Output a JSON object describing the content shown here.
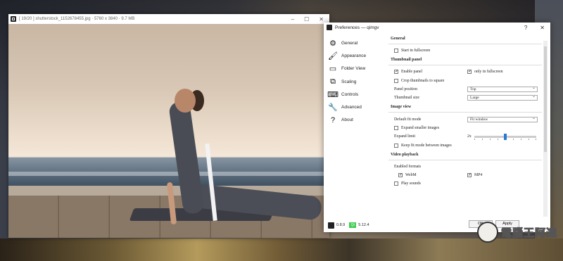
{
  "viewer": {
    "title": "[ 19/20 ] shutterstock_1152678455.jpg · 5760 x 3840 · 9.7 MB"
  },
  "prefs": {
    "title": "Preferences — qimgv",
    "help_glyph": "?",
    "close_glyph": "✕",
    "sidebar": [
      {
        "label": "General",
        "icon": "gear-icon"
      },
      {
        "label": "Appearance",
        "icon": "brush-icon"
      },
      {
        "label": "Folder View",
        "icon": "folder-icon"
      },
      {
        "label": "Scaling",
        "icon": "scaling-icon"
      },
      {
        "label": "Controls",
        "icon": "keyboard-icon"
      },
      {
        "label": "Advanced",
        "icon": "wrench-icon"
      },
      {
        "label": "About",
        "icon": "question-icon"
      }
    ],
    "general": {
      "heading": "General",
      "start_fullscreen": "Start in fullscreen"
    },
    "thumbnail": {
      "heading": "Thumbnail panel",
      "enable_panel": "Enable panel",
      "only_fullscreen": "only in fullscreen",
      "crop_thumbnails": "Crop thumbnails to square",
      "panel_position_label": "Panel position",
      "panel_position_value": "Top",
      "thumbnail_size_label": "Thumbnail size",
      "thumbnail_size_value": "Large"
    },
    "imageview": {
      "heading": "Image view",
      "default_fit_label": "Default fit mode",
      "default_fit_value": "Fit window",
      "expand_smaller": "Expand smaller images",
      "expand_limit_label": "Expand limit",
      "expand_limit_value": "2x",
      "keep_fit": "Keep fit mode between images"
    },
    "video": {
      "heading": "Video playback",
      "enabled_formats": "Enabled formats",
      "webm": "WebM",
      "mp4": "MP4",
      "play_sounds": "Play sounds"
    },
    "footer": {
      "version": "0.8.9",
      "qt_badge": "Qt",
      "qt_version": "5.12.4",
      "ok": "OK",
      "apply": "Apply"
    }
  },
  "watermark": {
    "text": "電腦王阿達"
  }
}
